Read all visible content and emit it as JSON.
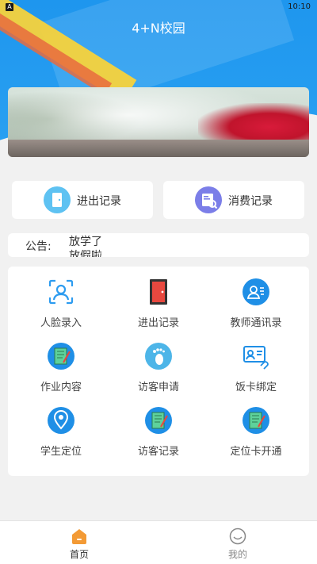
{
  "status": {
    "time": "10:10",
    "app_badge": "A"
  },
  "header": {
    "title": "4+N校园"
  },
  "quick_actions": [
    {
      "label": "进出记录",
      "icon": "door-icon"
    },
    {
      "label": "消费记录",
      "icon": "receipt-icon"
    }
  ],
  "notice": {
    "label": "公告:",
    "line1": "放学了",
    "line2": "放假啦"
  },
  "grid": [
    {
      "label": "人脸录入",
      "icon": "face-scan-icon"
    },
    {
      "label": "进出记录",
      "icon": "door-icon"
    },
    {
      "label": "教师通讯录",
      "icon": "contacts-icon"
    },
    {
      "label": "作业内容",
      "icon": "notebook-icon"
    },
    {
      "label": "访客申请",
      "icon": "footprint-icon"
    },
    {
      "label": "饭卡绑定",
      "icon": "id-card-link-icon"
    },
    {
      "label": "学生定位",
      "icon": "location-pin-icon"
    },
    {
      "label": "访客记录",
      "icon": "notebook-icon"
    },
    {
      "label": "定位卡开通",
      "icon": "notebook-icon"
    }
  ],
  "tabs": [
    {
      "label": "首页",
      "icon": "home-icon"
    },
    {
      "label": "我的",
      "icon": "smiley-icon"
    }
  ],
  "colors": {
    "primary": "#1e96ee",
    "accent": "#f39a35"
  }
}
